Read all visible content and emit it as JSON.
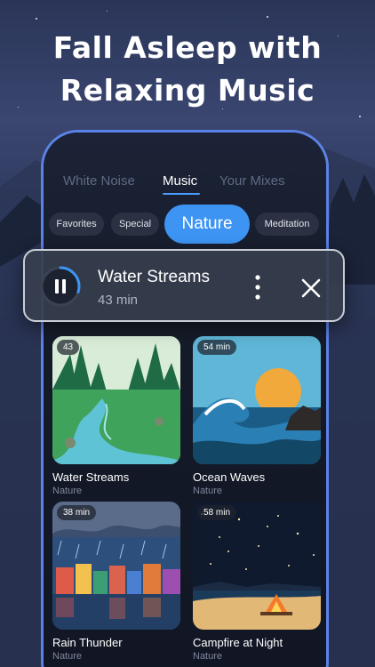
{
  "headline": {
    "line1": "Fall Asleep with",
    "line2": "Relaxing Music"
  },
  "tabs": [
    {
      "label": "White Noise",
      "active": false
    },
    {
      "label": "Music",
      "active": true
    },
    {
      "label": "Your Mixes",
      "active": false
    }
  ],
  "chips": [
    {
      "label": "Favorites",
      "active": false
    },
    {
      "label": "Special",
      "active": false
    },
    {
      "label": "Nature",
      "active": true
    },
    {
      "label": "Meditation",
      "active": false
    }
  ],
  "player": {
    "title": "Water Streams",
    "duration": "43 min",
    "progress": 0.3,
    "play_icon": "pause-icon",
    "more_icon": "more-vertical-icon",
    "close_icon": "close-icon"
  },
  "tracks": [
    {
      "title": "Water Streams",
      "category": "Nature",
      "badge": "43",
      "art": "forest-river"
    },
    {
      "title": "Ocean Waves",
      "category": "Nature",
      "badge": "54 min",
      "art": "ocean-wave"
    },
    {
      "title": "Rain Thunder",
      "category": "Nature",
      "badge": "38 min",
      "art": "rainy-town"
    },
    {
      "title": "Campfire at Night",
      "category": "Nature",
      "badge": "58 min",
      "art": "campfire-beach"
    }
  ],
  "colors": {
    "accent": "#3d94f2",
    "phone_frame": "#5b82e6",
    "background": "#1a2238"
  }
}
